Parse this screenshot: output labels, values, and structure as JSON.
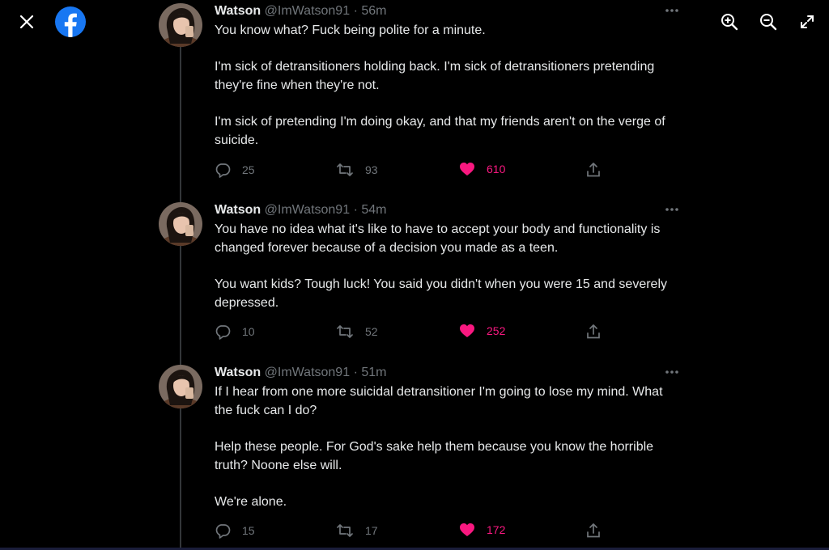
{
  "viewer": {
    "close_icon": "close-icon",
    "brand_icon": "facebook-logo-icon",
    "zoom_in_icon": "zoom-in-icon",
    "zoom_out_icon": "zoom-out-icon",
    "fullscreen_icon": "expand-icon",
    "brand_color": "#1877f2"
  },
  "colors": {
    "background": "#000000",
    "text": "#e7e9ea",
    "muted": "#71767b",
    "like": "#f91880"
  },
  "tweets": [
    {
      "name": "Watson",
      "handle": "@ImWatson91",
      "separator": "·",
      "time": "56m",
      "paragraphs": [
        "You know what? Fuck being polite for a minute.",
        "I'm sick of detransitioners holding back. I'm sick of detransitioners pretending they're fine when they're not.",
        "I'm sick of pretending I'm doing okay, and that my friends aren't on the verge of suicide."
      ],
      "replies": "25",
      "retweets": "93",
      "likes": "610"
    },
    {
      "name": "Watson",
      "handle": "@ImWatson91",
      "separator": "·",
      "time": "54m",
      "paragraphs": [
        "You have no idea what it's like to have to accept your body and functionality is changed forever because of a decision you made as a teen.",
        "You want kids? Tough luck! You said you didn't when you were 15 and severely depressed."
      ],
      "replies": "10",
      "retweets": "52",
      "likes": "252"
    },
    {
      "name": "Watson",
      "handle": "@ImWatson91",
      "separator": "·",
      "time": "51m",
      "paragraphs": [
        "If I hear from one more suicidal detransitioner I'm going to lose my mind. What the fuck can I do?",
        "Help these people. For God's sake help them because you know the horrible truth? Noone else will.",
        "We're alone."
      ],
      "replies": "15",
      "retweets": "17",
      "likes": "172"
    }
  ]
}
